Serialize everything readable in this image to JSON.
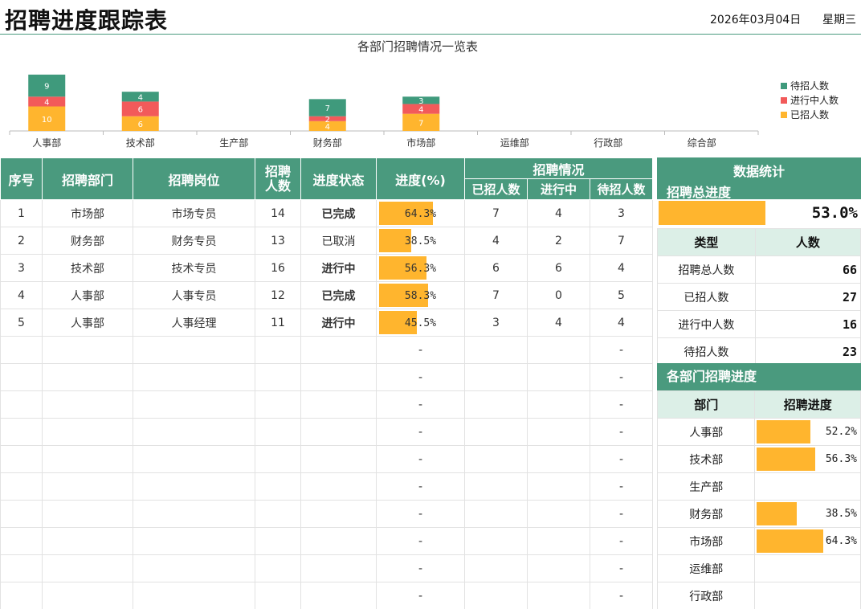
{
  "title": "招聘进度跟踪表",
  "date": "2026年03月04日",
  "weekday": "星期三",
  "colors": {
    "accent": "#4a9a7e",
    "light_accent": "#dcefe7",
    "pending": "#3f9a7c",
    "in_progress": "#f25a5a",
    "hired": "#ffb52e",
    "done_text": "#3c8f6e",
    "doing_text": "#e84a3c",
    "cancel_text": "#8a8a8a"
  },
  "chart_data": {
    "type": "bar",
    "title": "各部门招聘情况一览表",
    "categories": [
      "人事部",
      "技术部",
      "生产部",
      "财务部",
      "市场部",
      "运维部",
      "行政部",
      "综合部"
    ],
    "series": [
      {
        "name": "已招人数",
        "values": [
          10,
          6,
          0,
          4,
          7,
          0,
          0,
          0
        ]
      },
      {
        "name": "进行中人数",
        "values": [
          4,
          6,
          0,
          2,
          4,
          0,
          0,
          0
        ]
      },
      {
        "name": "待招人数",
        "values": [
          9,
          4,
          0,
          7,
          3,
          0,
          0,
          0
        ]
      }
    ],
    "stacked": true,
    "legend": [
      "待招人数",
      "进行中人数",
      "已招人数"
    ],
    "legend_position": "right",
    "ylim": [
      0,
      24
    ],
    "grid": false
  },
  "table": {
    "headers": {
      "seq": "序号",
      "dept": "招聘部门",
      "position": "招聘岗位",
      "count": "招聘人数",
      "status": "进度状态",
      "progress": "进度(%)",
      "situation": "招聘情况",
      "hired": "已招人数",
      "in_progress": "进行中",
      "pending": "待招人数"
    },
    "rows": [
      {
        "seq": "1",
        "dept": "市场部",
        "position": "市场专员",
        "count": "14",
        "status": "已完成",
        "status_type": "done",
        "progress": 0.643,
        "progress_text": "64.3%",
        "hired": "7",
        "in_progress": "4",
        "pending": "3"
      },
      {
        "seq": "2",
        "dept": "财务部",
        "position": "财务专员",
        "count": "13",
        "status": "已取消",
        "status_type": "cancel",
        "progress": 0.385,
        "progress_text": "38.5%",
        "hired": "4",
        "in_progress": "2",
        "pending": "7"
      },
      {
        "seq": "3",
        "dept": "技术部",
        "position": "技术专员",
        "count": "16",
        "status": "进行中",
        "status_type": "doing",
        "progress": 0.563,
        "progress_text": "56.3%",
        "hired": "6",
        "in_progress": "6",
        "pending": "4"
      },
      {
        "seq": "4",
        "dept": "人事部",
        "position": "人事专员",
        "count": "12",
        "status": "已完成",
        "status_type": "done",
        "progress": 0.583,
        "progress_text": "58.3%",
        "hired": "7",
        "in_progress": "0",
        "pending": "5"
      },
      {
        "seq": "5",
        "dept": "人事部",
        "position": "人事经理",
        "count": "11",
        "status": "进行中",
        "status_type": "doing",
        "progress": 0.455,
        "progress_text": "45.5%",
        "hired": "3",
        "in_progress": "4",
        "pending": "4"
      }
    ],
    "empty_dash": "-"
  },
  "stats": {
    "title": "数据统计",
    "total_progress_label": "招聘总进度",
    "total_progress": 0.53,
    "total_progress_text": "53.0%",
    "type_header": "类型",
    "count_header": "人数",
    "items": [
      {
        "label": "招聘总人数",
        "value": "66"
      },
      {
        "label": "已招人数",
        "value": "27"
      },
      {
        "label": "进行中人数",
        "value": "16"
      },
      {
        "label": "待招人数",
        "value": "23"
      }
    ]
  },
  "dept_progress": {
    "title": "各部门招聘进度",
    "dept_header": "部门",
    "progress_header": "招聘进度",
    "items": [
      {
        "dept": "人事部",
        "progress": 0.522,
        "text": "52.2%"
      },
      {
        "dept": "技术部",
        "progress": 0.563,
        "text": "56.3%"
      },
      {
        "dept": "生产部",
        "progress": 0,
        "text": ""
      },
      {
        "dept": "财务部",
        "progress": 0.385,
        "text": "38.5%"
      },
      {
        "dept": "市场部",
        "progress": 0.643,
        "text": "64.3%"
      },
      {
        "dept": "运维部",
        "progress": 0,
        "text": ""
      },
      {
        "dept": "行政部",
        "progress": 0,
        "text": ""
      }
    ]
  }
}
